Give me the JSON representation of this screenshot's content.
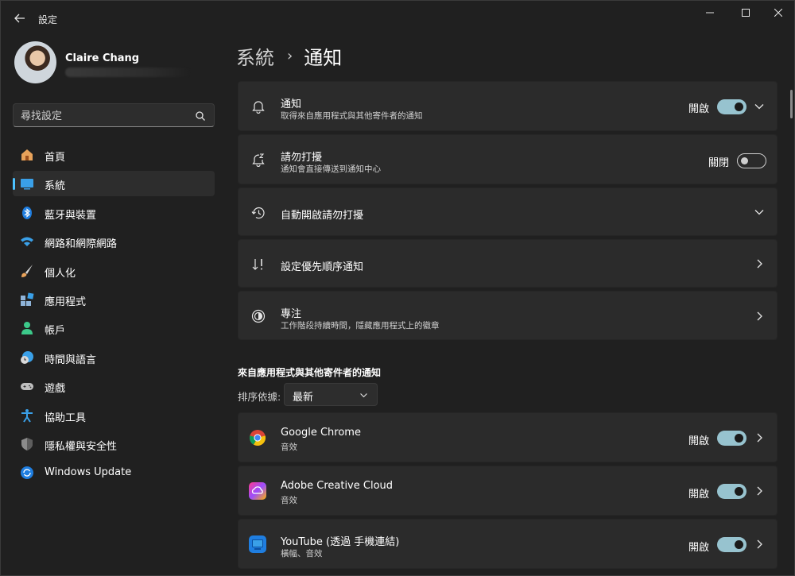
{
  "window": {
    "title": "設定",
    "controls": [
      "minimize-icon",
      "maximize-icon",
      "close-icon"
    ]
  },
  "user": {
    "name": "Claire Chang"
  },
  "search": {
    "placeholder": "尋找設定"
  },
  "sidebar": {
    "items": [
      {
        "label": "首頁",
        "icon": "home-icon",
        "selected": false
      },
      {
        "label": "系統",
        "icon": "system-monitor-icon",
        "selected": true
      },
      {
        "label": "藍牙與裝置",
        "icon": "bluetooth-icon",
        "selected": false
      },
      {
        "label": "網路和網際網路",
        "icon": "wifi-icon",
        "selected": false
      },
      {
        "label": "個人化",
        "icon": "paintbrush-icon",
        "selected": false
      },
      {
        "label": "應用程式",
        "icon": "apps-icon",
        "selected": false
      },
      {
        "label": "帳戶",
        "icon": "account-icon",
        "selected": false
      },
      {
        "label": "時間與語言",
        "icon": "globe-clock-icon",
        "selected": false
      },
      {
        "label": "遊戲",
        "icon": "gamepad-icon",
        "selected": false
      },
      {
        "label": "協助工具",
        "icon": "accessibility-icon",
        "selected": false
      },
      {
        "label": "隱私權與安全性",
        "icon": "shield-icon",
        "selected": false
      },
      {
        "label": "Windows Update",
        "icon": "windows-update-icon",
        "selected": false
      }
    ]
  },
  "breadcrumb": {
    "parent": "系統",
    "separator": "›",
    "current": "通知"
  },
  "settings": {
    "notifications": {
      "title": "通知",
      "subtitle": "取得來自應用程式與其他寄件者的通知",
      "state": "開啟",
      "on": true
    },
    "dnd": {
      "title": "請勿打擾",
      "subtitle": "通知會直接傳送到通知中心",
      "state": "關閉",
      "on": false
    },
    "auto_dnd": {
      "title": "自動開啟請勿打擾"
    },
    "priority": {
      "title": "設定優先順序通知"
    },
    "focus": {
      "title": "專注",
      "subtitle": "工作階段持續時間，隱藏應用程式上的徽章"
    }
  },
  "apps_section": {
    "title": "來自應用程式與其他寄件者的通知",
    "sort_label": "排序依據:",
    "sort_value": "最新",
    "apps": [
      {
        "name": "Google Chrome",
        "subtitle": "音效",
        "state": "開啟",
        "icon": "chrome-icon"
      },
      {
        "name": "Adobe Creative Cloud",
        "subtitle": "音效",
        "state": "開啟",
        "icon": "creative-cloud-icon"
      },
      {
        "name": "YouTube (透過 手機連結)",
        "subtitle": "橫幅、音效",
        "state": "開啟",
        "icon": "phone-link-icon"
      }
    ]
  },
  "colors": {
    "background": "#202020",
    "card": "#2b2b2b",
    "accent": "#4cc2ff",
    "toggle_on": "#97c3cf"
  }
}
